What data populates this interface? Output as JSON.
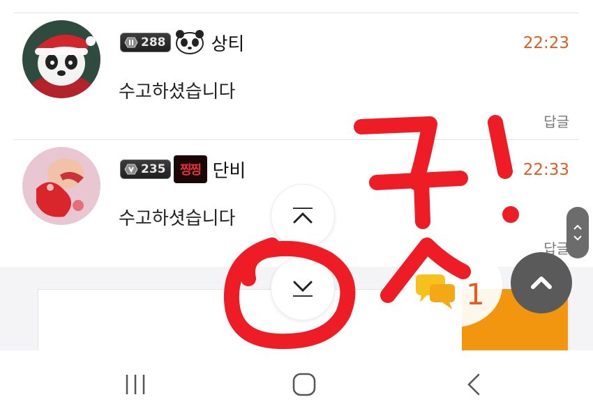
{
  "comments": [
    {
      "level": "288",
      "nickname": "상티",
      "time": "22:23",
      "text": "수고하셨습니다",
      "reply_label": "답글",
      "avatar_icon": "panda-santa-avatar",
      "user_icon": "panda-icon"
    },
    {
      "level": "235",
      "nickname": "단비",
      "time": "22:33",
      "text": "수고하셧습니다",
      "reply_label": "답글",
      "avatar_icon": "anime-avatar",
      "user_icon": "zzing-badge-icon",
      "user_icon_text": "찡찡"
    }
  ],
  "chat_fab": {
    "count": "1",
    "icon": "chat-bubbles-icon"
  },
  "navigation": {
    "scroll_up_icon": "chevron-up-icon",
    "scroll_down_icon": "chevron-down-icon",
    "back_to_top_icon": "chevron-up-icon"
  },
  "system_nav": {
    "recents_icon": "recents-icon",
    "home_icon": "home-icon",
    "back_icon": "back-icon"
  },
  "colors": {
    "time": "#e25b1e",
    "scribble": "#ee1c24",
    "orange": "#f1960e",
    "fab": "#5a5a5a"
  },
  "annotation": {
    "handwriting": "굿!"
  }
}
